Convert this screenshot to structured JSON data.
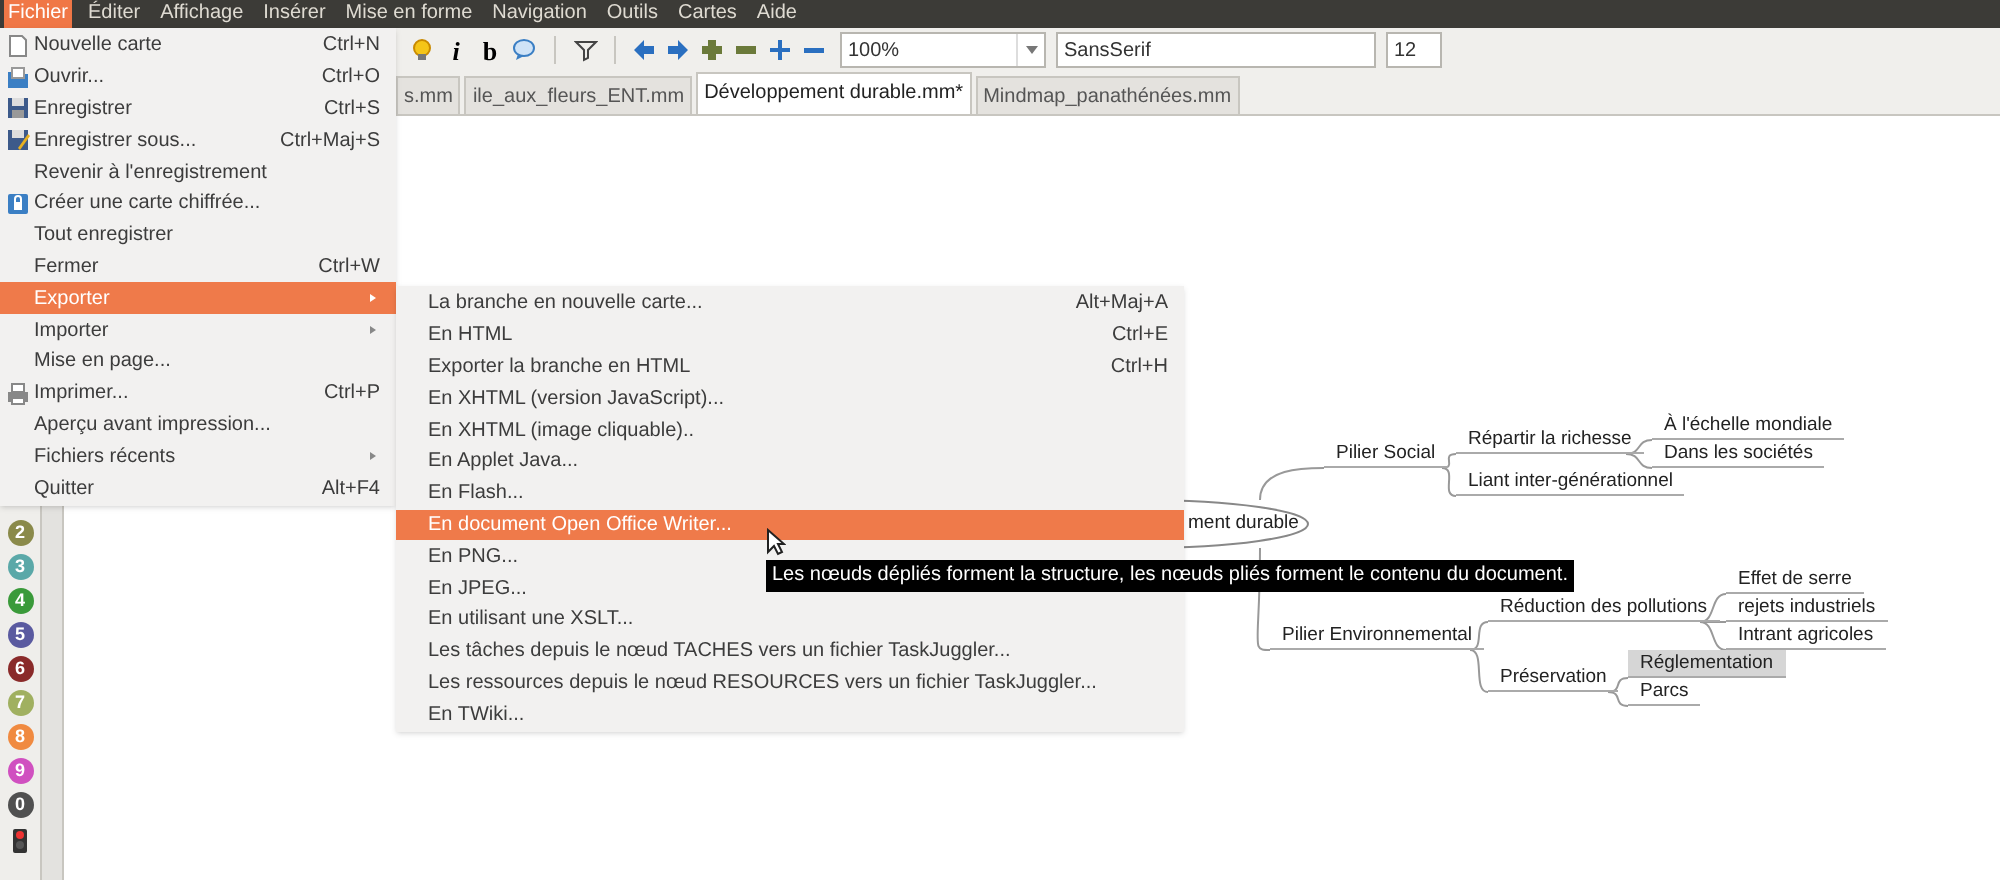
{
  "menu_bar": [
    {
      "label": "Fichier",
      "selected": true
    },
    {
      "label": "Éditer",
      "selected": false
    },
    {
      "label": "Affichage",
      "selected": false
    },
    {
      "label": "Insérer",
      "selected": false
    },
    {
      "label": "Mise en forme",
      "selected": false
    },
    {
      "label": "Navigation",
      "selected": false
    },
    {
      "label": "Outils",
      "selected": false
    },
    {
      "label": "Cartes",
      "selected": false
    },
    {
      "label": "Aide",
      "selected": false
    }
  ],
  "toolbar": {
    "italic_label": "i",
    "bold_label": "b",
    "zoom": "100%",
    "font": "SansSerif",
    "font_size": "12"
  },
  "tabs": [
    {
      "label": "s.mm",
      "selected": false
    },
    {
      "label": "ile_aux_fleurs_ENT.mm",
      "selected": false
    },
    {
      "label": "Développement durable.mm*",
      "selected": true
    },
    {
      "label": "Mindmap_panathénées.mm",
      "selected": false
    }
  ],
  "sidebar": {
    "icons": [
      {
        "label": "2",
        "color": "#8a8a4a"
      },
      {
        "label": "3",
        "color": "#5aa8a8"
      },
      {
        "label": "4",
        "color": "#3a9a3a"
      },
      {
        "label": "5",
        "color": "#5a5aa0"
      },
      {
        "label": "6",
        "color": "#8a2a2a"
      },
      {
        "label": "7",
        "color": "#a0b060"
      },
      {
        "label": "8",
        "color": "#f08a40"
      },
      {
        "label": "9",
        "color": "#d050c0"
      },
      {
        "label": "0",
        "color": "#505050"
      }
    ]
  },
  "mind_map": {
    "root": {
      "text": "ment durable",
      "children": [
        {
          "text": "Pilier Social",
          "selected": false,
          "children": [
            {
              "text": "Répartir la richesse",
              "selected": false,
              "children": [
                {
                  "text": "À l'échelle mondiale",
                  "selected": false
                },
                {
                  "text": "Dans les sociétés",
                  "selected": false
                }
              ]
            },
            {
              "text": "Liant inter-générationnel",
              "selected": false
            }
          ]
        },
        {
          "text": "Pilier Environnemental",
          "selected": false,
          "children": [
            {
              "text": "Réduction des pollutions",
              "selected": false,
              "children": [
                {
                  "text": "Effet de serre",
                  "selected": false
                },
                {
                  "text": "rejets industriels",
                  "selected": false
                },
                {
                  "text": "Intrant agricoles",
                  "selected": false
                }
              ]
            },
            {
              "text": "Préservation",
              "selected": false,
              "children": [
                {
                  "text": "Réglementation",
                  "selected": true
                },
                {
                  "text": "Parcs",
                  "selected": false
                }
              ]
            }
          ]
        }
      ]
    }
  },
  "file_menu": [
    {
      "label": "Nouvelle carte",
      "shortcut": "Ctrl+N",
      "selected": false,
      "submenu": false
    },
    {
      "label": "Ouvrir...",
      "shortcut": "Ctrl+O",
      "selected": false,
      "submenu": false
    },
    {
      "label": "Enregistrer",
      "shortcut": "Ctrl+S",
      "selected": false,
      "submenu": false
    },
    {
      "label": "Enregistrer sous...",
      "shortcut": "Ctrl+Maj+S",
      "selected": false,
      "submenu": false
    },
    {
      "label": "Revenir à l'enregistrement",
      "selected": false,
      "submenu": false
    },
    {
      "label": "Créer une carte chiffrée...",
      "selected": false,
      "submenu": false
    },
    {
      "label": "Tout enregistrer",
      "selected": false,
      "submenu": false
    },
    {
      "label": "Fermer",
      "shortcut": "Ctrl+W",
      "selected": false,
      "submenu": false
    },
    {
      "label": "Exporter",
      "selected": true,
      "submenu": true
    },
    {
      "label": "Importer",
      "selected": false,
      "submenu": true
    },
    {
      "label": "Mise en page...",
      "selected": false,
      "submenu": false
    },
    {
      "label": "Imprimer...",
      "shortcut": "Ctrl+P",
      "selected": false,
      "submenu": false
    },
    {
      "label": "Aperçu avant impression...",
      "selected": false,
      "submenu": false
    },
    {
      "label": "Fichiers récents",
      "selected": false,
      "submenu": true
    },
    {
      "label": "Quitter",
      "shortcut": "Alt+F4",
      "selected": false,
      "submenu": false
    }
  ],
  "export_submenu": [
    {
      "label": "La branche en nouvelle carte...",
      "shortcut": "Alt+Maj+A",
      "selected": false
    },
    {
      "label": "En HTML",
      "shortcut": "Ctrl+E",
      "selected": false
    },
    {
      "label": "Exporter la branche en HTML",
      "shortcut": "Ctrl+H",
      "selected": false
    },
    {
      "label": "En XHTML (version JavaScript)...",
      "selected": false
    },
    {
      "label": "En XHTML (image cliquable)..",
      "selected": false
    },
    {
      "label": "En Applet Java...",
      "selected": false
    },
    {
      "label": "En Flash...",
      "selected": false
    },
    {
      "label": "En document Open Office Writer...",
      "selected": true
    },
    {
      "label": "En PNG...",
      "selected": false
    },
    {
      "label": "En JPEG...",
      "selected": false
    },
    {
      "label": "En utilisant une XSLT...",
      "selected": false
    },
    {
      "label": "Les tâches depuis le nœud TACHES vers un fichier TaskJuggler...",
      "selected": false
    },
    {
      "label": "Les ressources depuis le nœud RESOURCES vers un fichier TaskJuggler...",
      "selected": false
    },
    {
      "label": "En TWiki...",
      "selected": false
    }
  ],
  "tooltip": "Les nœuds dépliés forment la structure, les nœuds pliés forment le contenu du document."
}
